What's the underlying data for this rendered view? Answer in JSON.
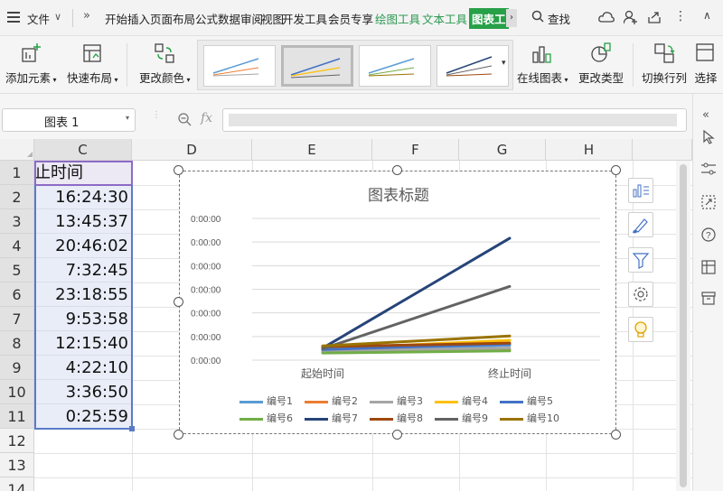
{
  "menubar": {
    "file": "文件",
    "tabs": [
      "开始",
      "插入",
      "页面布局",
      "公式",
      "数据",
      "审阅",
      "视图",
      "开发工具",
      "会员专享",
      "绘图工具",
      "文本工具",
      "图表工"
    ],
    "search": "查找"
  },
  "ribbon": {
    "add_element": "添加元素",
    "quick_layout": "快速布局",
    "change_color": "更改颜色",
    "online_chart": "在线图表",
    "change_type": "更改类型",
    "switch_rowcol": "切换行列",
    "select": "选择"
  },
  "formula_bar": {
    "name_box": "图表 1",
    "fx": "fx",
    "formula": ""
  },
  "grid": {
    "col_headers": [
      "C",
      "D",
      "E",
      "F",
      "G",
      "H"
    ],
    "row_headers": [
      "1",
      "2",
      "3",
      "4",
      "5",
      "6",
      "7",
      "8",
      "9",
      "10",
      "11",
      "12",
      "13",
      "14"
    ],
    "cells": [
      "止时间",
      "16:24:30",
      "13:45:37",
      "20:46:02",
      "7:32:45",
      "23:18:55",
      "9:53:58",
      "12:15:40",
      "4:22:10",
      "3:36:50",
      "0:25:59"
    ]
  },
  "chart_data": {
    "type": "line",
    "title": "图表标题",
    "categories": [
      "起始时间",
      "终止时间"
    ],
    "y_tick_labels": [
      "0:00:00",
      "0:00:00",
      "0:00:00",
      "0:00:00",
      "0:00:00",
      "0:00:00",
      "0:00:00"
    ],
    "series": [
      {
        "name": "编号1",
        "color": "#5b9bd5",
        "values": [
          0.07,
          0.105
        ]
      },
      {
        "name": "编号2",
        "color": "#ed7d31",
        "values": [
          0.06,
          0.07
        ]
      },
      {
        "name": "编号3",
        "color": "#a5a5a5",
        "values": [
          0.065,
          0.085
        ]
      },
      {
        "name": "编号4",
        "color": "#ffc000",
        "values": [
          0.08,
          0.14
        ]
      },
      {
        "name": "编号5",
        "color": "#4472c4",
        "values": [
          0.075,
          0.115
        ]
      },
      {
        "name": "编号6",
        "color": "#70ad47",
        "values": [
          0.05,
          0.065
        ]
      },
      {
        "name": "编号7",
        "color": "#264478",
        "values": [
          0.085,
          0.86
        ]
      },
      {
        "name": "编号8",
        "color": "#9e480e",
        "values": [
          0.095,
          0.12
        ]
      },
      {
        "name": "编号9",
        "color": "#636363",
        "values": [
          0.08,
          0.52
        ]
      },
      {
        "name": "编号10",
        "color": "#997300",
        "values": [
          0.1,
          0.17
        ]
      }
    ],
    "ylim": [
      0,
      1
    ],
    "grid": true,
    "legend": "bottom"
  },
  "colors": {
    "selection_fill": "#e8edf8",
    "accent_green": "#27a048"
  }
}
